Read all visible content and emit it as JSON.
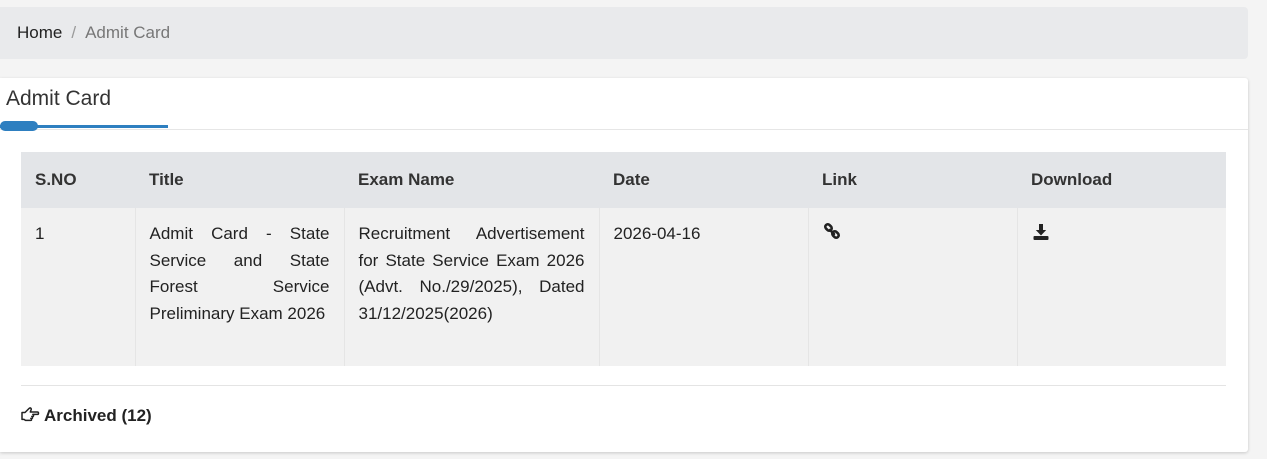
{
  "breadcrumb": {
    "home_label": "Home",
    "separator": "/",
    "current_label": "Admit Card"
  },
  "panel": {
    "title": "Admit Card",
    "accent_color": "#2e7fc0"
  },
  "table": {
    "headers": [
      "S.NO",
      "Title",
      "Exam Name",
      "Date",
      "Link",
      "Download"
    ],
    "rows": [
      {
        "sno": "1",
        "title": "Admit Card - State Service and State Forest Service Preliminary Exam 2026",
        "exam_name": "Recruitment Advertisement for State Service Exam 2026 (Advt. No./29/2025), Dated 31/12/2025(2026)",
        "date": "2026-04-16",
        "link_icon": "link-icon",
        "download_icon": "download-icon"
      }
    ]
  },
  "archived": {
    "icon": "hand-pointing-right-icon",
    "label": "Archived (12)"
  }
}
